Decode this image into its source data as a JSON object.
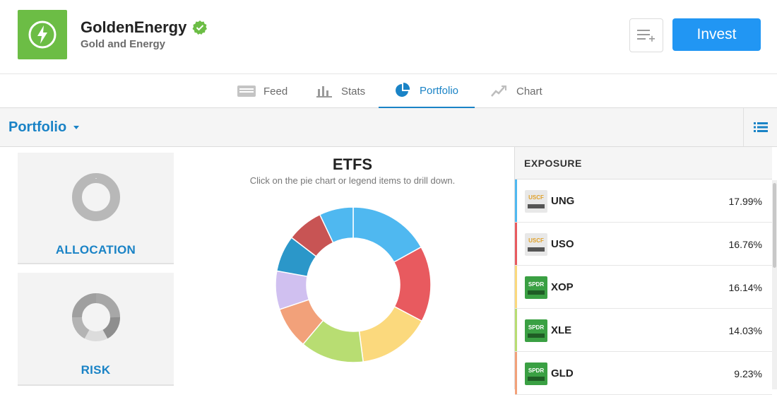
{
  "header": {
    "name": "GoldenEnergy",
    "subtitle": "Gold and Energy",
    "invest_label": "Invest",
    "brand_color": "#6cbd45",
    "accent_color": "#2196f3"
  },
  "tabs": [
    {
      "label": "Feed",
      "icon": "feed-icon",
      "active": false
    },
    {
      "label": "Stats",
      "icon": "stats-icon",
      "active": false
    },
    {
      "label": "Portfolio",
      "icon": "portfolio-icon",
      "active": true
    },
    {
      "label": "Chart",
      "icon": "chart-icon",
      "active": false
    }
  ],
  "subbar": {
    "title": "Portfolio"
  },
  "cards": [
    {
      "label": "ALLOCATION",
      "icon": "allocation-donut-icon"
    },
    {
      "label": "RISK",
      "icon": "risk-donut-icon"
    }
  ],
  "chart": {
    "title": "ETFS",
    "subtitle": "Click on the pie chart or legend items to drill down."
  },
  "chart_data": {
    "type": "pie",
    "title": "ETFS",
    "categories": [
      "UNG",
      "USO",
      "XOP",
      "XLE",
      "GLD",
      "",
      "",
      "",
      ""
    ],
    "values": [
      17.99,
      16.76,
      16.14,
      14.03,
      9.23,
      8.5,
      8.0,
      8.0,
      7.5
    ],
    "colors": [
      "#4fb8f0",
      "#e85a5f",
      "#fbd97d",
      "#b8dd72",
      "#f2a17a",
      "#d0c0f0",
      "#2b97c9",
      "#c85454",
      "#4fb8f0"
    ],
    "inner_radius_ratio": 0.6
  },
  "exposure": {
    "header": "EXPOSURE",
    "rows": [
      {
        "symbol": "UNG",
        "pct": "17.99%",
        "color": "#4fb8f0",
        "issuer": "USCF",
        "sub": "UNG"
      },
      {
        "symbol": "USO",
        "pct": "16.76%",
        "color": "#e85a5f",
        "issuer": "USCF",
        "sub": "USO"
      },
      {
        "symbol": "XOP",
        "pct": "16.14%",
        "color": "#fbd97d",
        "issuer": "SPDR",
        "sub": "XOP"
      },
      {
        "symbol": "XLE",
        "pct": "14.03%",
        "color": "#b8dd72",
        "issuer": "SPDR",
        "sub": "XLE"
      },
      {
        "symbol": "GLD",
        "pct": "9.23%",
        "color": "#f2a17a",
        "issuer": "SPDR",
        "sub": "GLD"
      }
    ]
  }
}
